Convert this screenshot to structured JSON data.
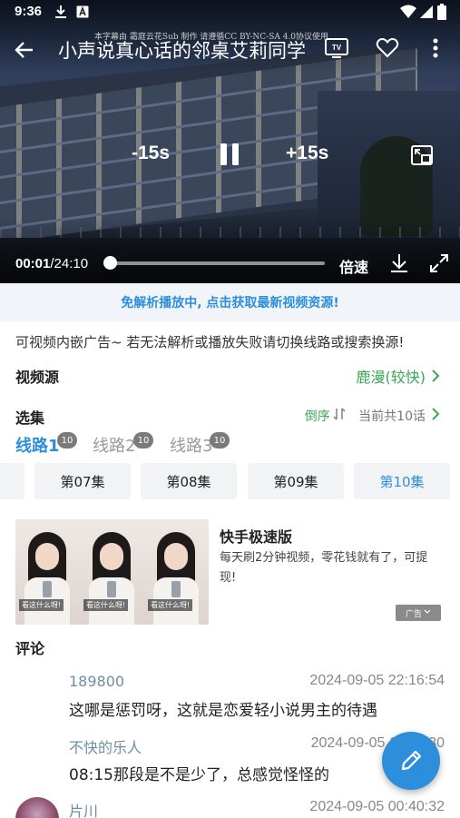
{
  "status_bar": {
    "time": "9:36"
  },
  "player": {
    "title": "小声说真心话的邻桌艾莉同学",
    "watermark": "本字幕由 霜庭云花Sub 制作 请遵循CC BY-NC-SA 4.0协议使用",
    "rewind_label": "-15s",
    "forward_label": "+15s",
    "current_time": "00:01",
    "duration": "/24:10",
    "progress": 0.0007,
    "speed_label": "倍速"
  },
  "banner": {
    "text": "免解析播放中, 点击获取最新视频资源!"
  },
  "notice": {
    "text": "可视频内嵌广告~ 若无法解析或播放失败请切换线路或搜索换源!"
  },
  "source": {
    "label": "视频源",
    "value": "鹿漫(较快)"
  },
  "episodes": {
    "label": "选集",
    "sort_label": "倒序",
    "count_label": "当前共10话",
    "lines": [
      {
        "label": "线路1",
        "badge": "10",
        "active": true
      },
      {
        "label": "线路2",
        "badge": "10",
        "active": false
      },
      {
        "label": "线路3",
        "badge": "10",
        "active": false
      }
    ],
    "items": [
      {
        "label": "第07集",
        "active": false
      },
      {
        "label": "第08集",
        "active": false
      },
      {
        "label": "第09集",
        "active": false
      },
      {
        "label": "第10集",
        "active": true
      }
    ]
  },
  "ad": {
    "title": "快手极速版",
    "description": "每天刷2分钟视频，零花钱就有了，可提现!",
    "tag": "广告",
    "image_caption": "看这什么呀!"
  },
  "comments": {
    "title": "评论",
    "items": [
      {
        "user": "189800",
        "time": "2024-09-05 22:16:54",
        "text": "这哪是惩罚呀，这就是恋爱轻小说男主的待遇"
      },
      {
        "user": "不快的乐人",
        "time": "2024-09-05 11:36:30",
        "text": "08:15那段是不是少了，总感觉怪怪的"
      },
      {
        "user": "片川",
        "time": "2024-09-05 00:40:32",
        "text": ""
      }
    ]
  },
  "colors": {
    "accent": "#2d8fdc",
    "green": "#3aa655",
    "badge": "#7a7a7a"
  },
  "icons": [
    "download-icon",
    "a-box-icon",
    "wifi-icon",
    "signal-icon",
    "battery-icon",
    "back-icon",
    "tv-cast-icon",
    "heart-icon",
    "more-icon",
    "pause-icon",
    "pip-icon",
    "download-video-icon",
    "fullscreen-icon",
    "edit-icon"
  ]
}
